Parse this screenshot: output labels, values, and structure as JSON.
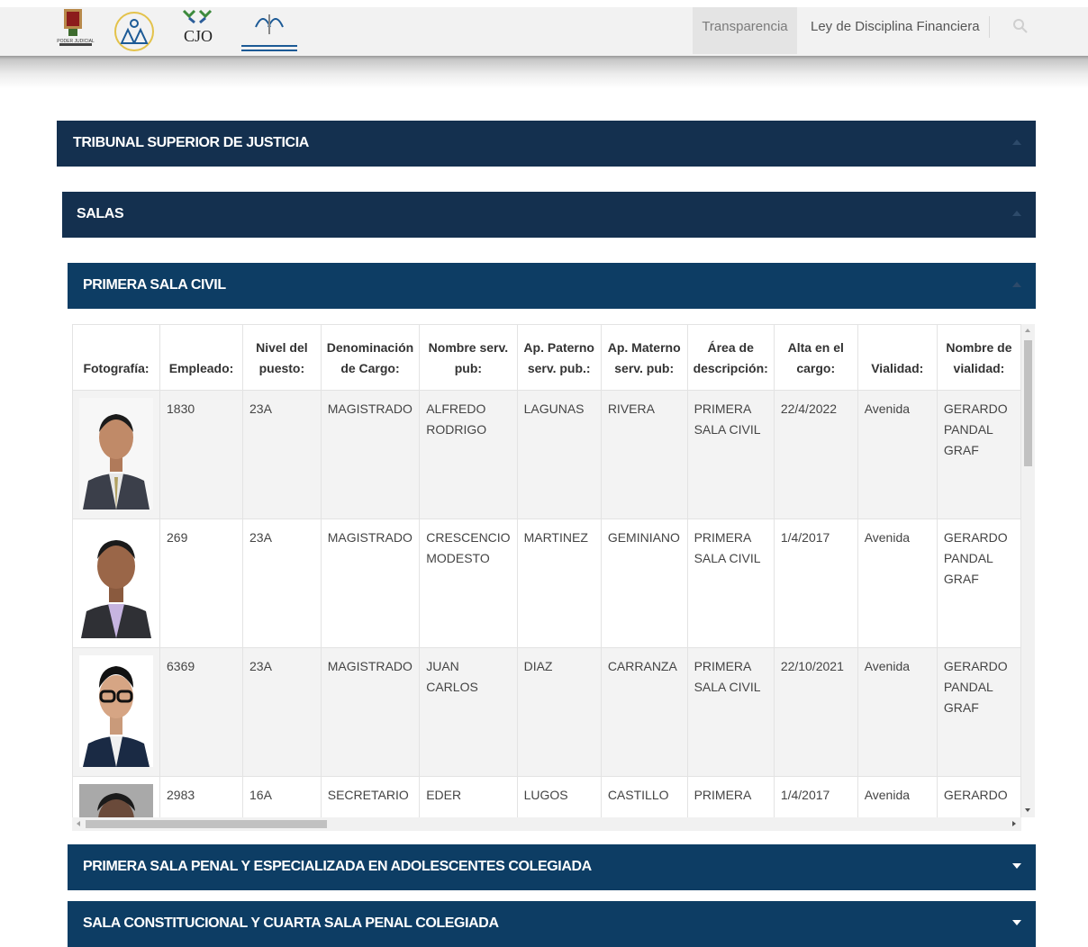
{
  "header": {
    "logos": [
      "poder-judicial-logo",
      "tribunal-emblem-logo",
      "cjo-logo",
      "derechos-humanos-logo"
    ],
    "cjo_text": "CJO",
    "poder_text": "PODER JUDICIAL",
    "nav": {
      "transparencia": "Transparencia",
      "ley": "Ley de Disciplina Financiera"
    }
  },
  "sections": {
    "tribunal": "TRIBUNAL SUPERIOR DE JUSTICIA",
    "salas": "SALAS",
    "primera_civil": "PRIMERA SALA CIVIL",
    "primera_penal": "PRIMERA SALA PENAL Y ESPECIALIZADA EN ADOLESCENTES COLEGIADA",
    "constitucional": "SALA CONSTITUCIONAL Y CUARTA SALA PENAL COLEGIADA"
  },
  "table": {
    "headers": [
      "Fotografía:",
      "Empleado:",
      "Nivel del puesto:",
      "Denominación de Cargo:",
      "Nombre serv. pub:",
      "Ap. Paterno serv. pub.:",
      "Ap. Materno serv. pub:",
      "Área de descripción:",
      "Alta en el cargo:",
      "Vialidad:",
      "Nombre de vialidad:"
    ],
    "rows": [
      {
        "empleado": "1830",
        "nivel": "23A",
        "cargo": "MAGISTRADO",
        "nombre": "ALFREDO RODRIGO",
        "paterno": "LAGUNAS",
        "materno": "RIVERA",
        "area": "PRIMERA SALA CIVIL",
        "alta": "22/4/2022",
        "vialidad": "Avenida",
        "nombre_vialidad": "GERARDO PANDAL GRAF"
      },
      {
        "empleado": "269",
        "nivel": "23A",
        "cargo": "MAGISTRADO",
        "nombre": "CRESCENCIO MODESTO",
        "paterno": "MARTINEZ",
        "materno": "GEMINIANO",
        "area": "PRIMERA SALA CIVIL",
        "alta": "1/4/2017",
        "vialidad": "Avenida",
        "nombre_vialidad": "GERARDO PANDAL GRAF"
      },
      {
        "empleado": "6369",
        "nivel": "23A",
        "cargo": "MAGISTRADO",
        "nombre": "JUAN CARLOS",
        "paterno": "DIAZ",
        "materno": "CARRANZA",
        "area": "PRIMERA SALA CIVIL",
        "alta": "22/10/2021",
        "vialidad": "Avenida",
        "nombre_vialidad": "GERARDO PANDAL GRAF"
      },
      {
        "empleado": "2983",
        "nivel": "16A",
        "cargo": "SECRETARIO",
        "nombre": "EDER",
        "paterno": "LUGOS",
        "materno": "CASTILLO",
        "area": "PRIMERA",
        "alta": "1/4/2017",
        "vialidad": "Avenida",
        "nombre_vialidad": "GERARDO"
      }
    ]
  },
  "colors": {
    "bar_dark": "#14304f",
    "bar_mid": "#0d3d64",
    "row_alt": "#f3f3f3"
  }
}
